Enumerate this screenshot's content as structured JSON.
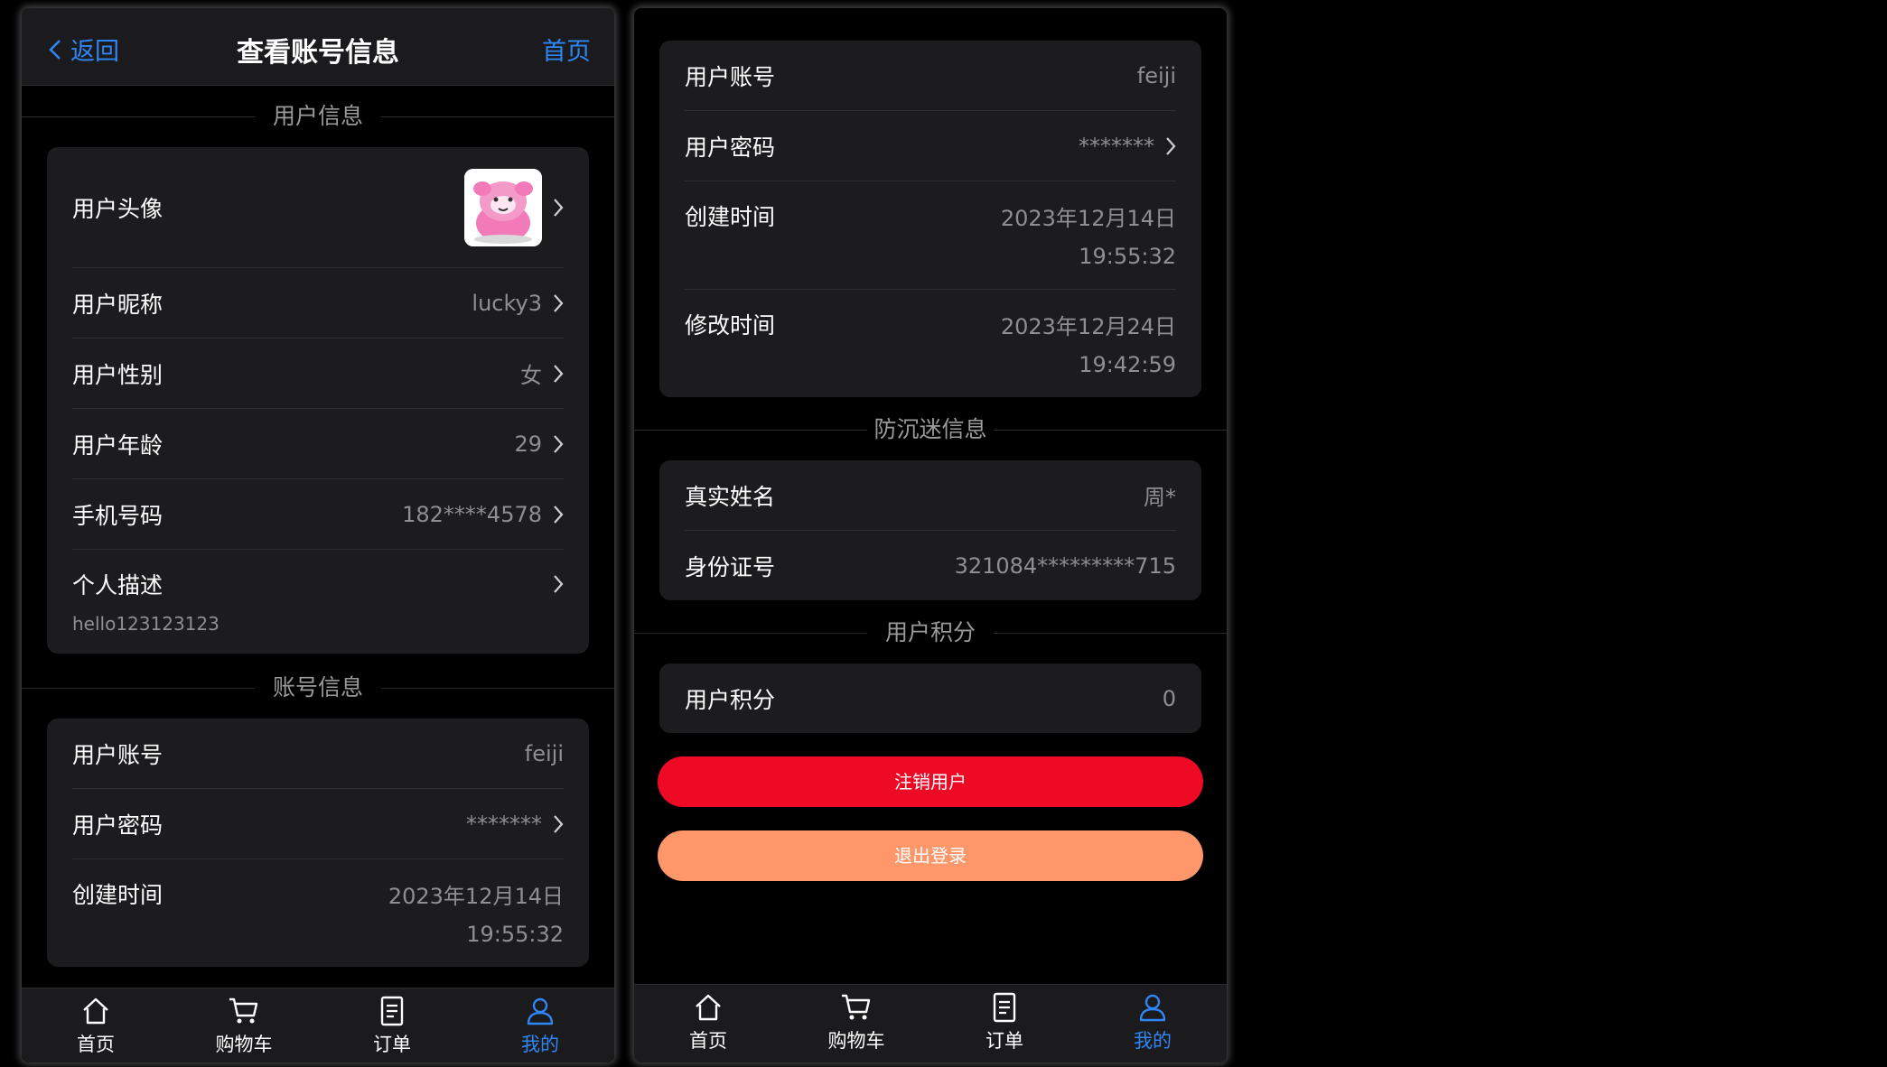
{
  "left": {
    "nav": {
      "back": "返回",
      "title": "查看账号信息",
      "home": "首页"
    },
    "sections": {
      "user_info": "用户信息",
      "account_info": "账号信息"
    },
    "user_info": {
      "avatar_label": "用户头像",
      "nickname_label": "用户昵称",
      "nickname": "lucky3",
      "gender_label": "用户性别",
      "gender": "女",
      "age_label": "用户年龄",
      "age": "29",
      "phone_label": "手机号码",
      "phone": "182****4578",
      "desc_label": "个人描述",
      "desc": "hello123123123"
    },
    "account": {
      "account_label": "用户账号",
      "account": "feiji",
      "password_label": "用户密码",
      "password": "*******",
      "created_label": "创建时间",
      "created_date": "2023年12月14日",
      "created_time": "19:55:32"
    }
  },
  "right": {
    "account": {
      "account_label": "用户账号",
      "account": "feiji",
      "password_label": "用户密码",
      "password": "*******",
      "created_label": "创建时间",
      "created_date": "2023年12月14日",
      "created_time": "19:55:32",
      "modified_label": "修改时间",
      "modified_date": "2023年12月24日",
      "modified_time": "19:42:59"
    },
    "sections": {
      "anti_addiction": "防沉迷信息",
      "points": "用户积分"
    },
    "anti_addiction": {
      "name_label": "真实姓名",
      "name": "周*",
      "id_label": "身份证号",
      "id": "321084*********715"
    },
    "points": {
      "label": "用户积分",
      "value": "0"
    },
    "buttons": {
      "deregister": "注销用户",
      "logout": "退出登录"
    }
  },
  "tabbar": {
    "home": "首页",
    "cart": "购物车",
    "orders": "订单",
    "mine": "我的",
    "active": "mine"
  },
  "colors": {
    "accent": "#2f86f6",
    "danger": "#ee0a24",
    "warning": "#ff976a",
    "card": "#1c1c1e",
    "background": "#000000"
  }
}
